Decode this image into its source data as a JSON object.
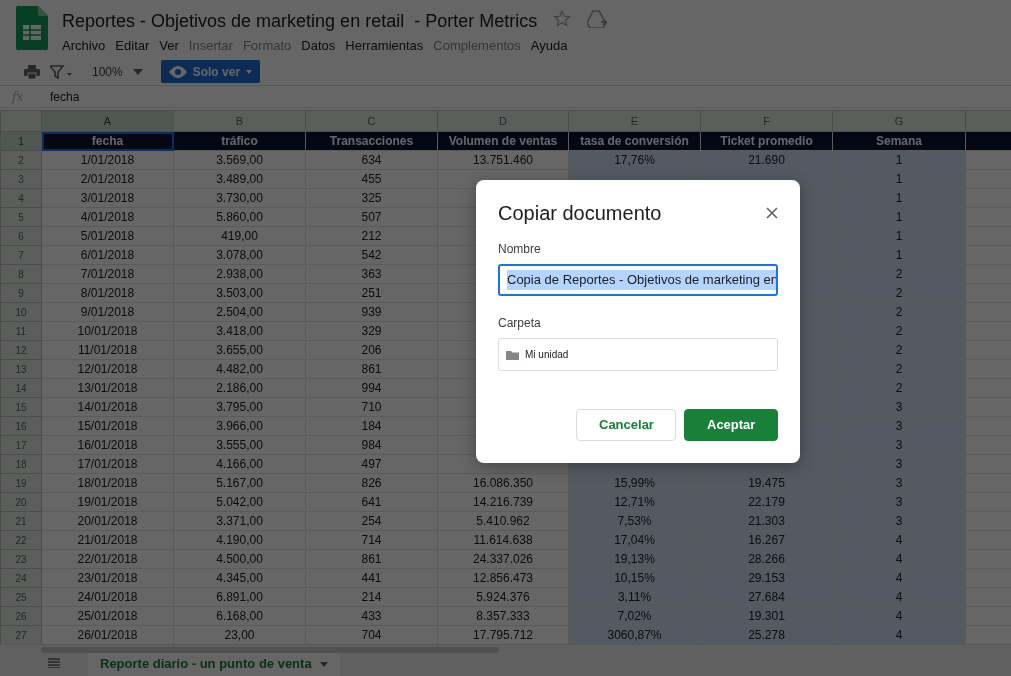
{
  "app": {
    "title": "Reportes - Objetivos de marketing en retail  - Porter Metrics",
    "starred": false,
    "menu": [
      {
        "label": "Archivo",
        "disabled": false
      },
      {
        "label": "Editar",
        "disabled": false
      },
      {
        "label": "Ver",
        "disabled": false
      },
      {
        "label": "Insertar",
        "disabled": true
      },
      {
        "label": "Formato",
        "disabled": true
      },
      {
        "label": "Datos",
        "disabled": false
      },
      {
        "label": "Herramientas",
        "disabled": false
      },
      {
        "label": "Complementos",
        "disabled": true
      },
      {
        "label": "Ayuda",
        "disabled": false
      }
    ]
  },
  "toolbar": {
    "zoom": "100%",
    "mode_button": "Solo ver"
  },
  "formula_bar": {
    "fx": "fx",
    "value": "fecha"
  },
  "sheet": {
    "columns": [
      {
        "label": "A",
        "highlighted": false,
        "selected": true
      },
      {
        "label": "B",
        "highlighted": false,
        "selected": false
      },
      {
        "label": "C",
        "highlighted": false,
        "selected": false
      },
      {
        "label": "D",
        "highlighted": false,
        "selected": false
      },
      {
        "label": "E",
        "highlighted": true,
        "selected": false
      },
      {
        "label": "F",
        "highlighted": true,
        "selected": false
      },
      {
        "label": "G",
        "highlighted": true,
        "selected": false
      }
    ],
    "rows": [
      {
        "number": "1",
        "header": true,
        "cells": [
          "fecha",
          "tráfico",
          "Transacciones",
          "Volumen de ventas",
          "tasa de conversión",
          "Ticket promedio",
          "Semana"
        ]
      },
      {
        "number": "2",
        "header": false,
        "cells": [
          "1/01/2018",
          "3.569,00",
          "634",
          "13.751.460",
          "17,76%",
          "21.690",
          "1"
        ]
      },
      {
        "number": "3",
        "header": false,
        "cells": [
          "2/01/2018",
          "3.489,00",
          "455",
          null,
          null,
          null,
          "1"
        ]
      },
      {
        "number": "4",
        "header": false,
        "cells": [
          "3/01/2018",
          "3.730,00",
          "325",
          null,
          null,
          null,
          "1"
        ]
      },
      {
        "number": "5",
        "header": false,
        "cells": [
          "4/01/2018",
          "5.860,00",
          "507",
          null,
          null,
          null,
          "1"
        ]
      },
      {
        "number": "6",
        "header": false,
        "cells": [
          "5/01/2018",
          "419,00",
          "212",
          null,
          null,
          null,
          "1"
        ]
      },
      {
        "number": "7",
        "header": false,
        "cells": [
          "6/01/2018",
          "3.078,00",
          "542",
          null,
          null,
          null,
          "1"
        ]
      },
      {
        "number": "8",
        "header": false,
        "cells": [
          "7/01/2018",
          "2.938,00",
          "363",
          null,
          null,
          null,
          "2"
        ]
      },
      {
        "number": "9",
        "header": false,
        "cells": [
          "8/01/2018",
          "3.503,00",
          "251",
          null,
          null,
          null,
          "2"
        ]
      },
      {
        "number": "10",
        "header": false,
        "cells": [
          "9/01/2018",
          "2.504,00",
          "939",
          null,
          null,
          null,
          "2"
        ]
      },
      {
        "number": "11",
        "header": false,
        "cells": [
          "10/01/2018",
          "3.418,00",
          "329",
          null,
          null,
          null,
          "2"
        ]
      },
      {
        "number": "12",
        "header": false,
        "cells": [
          "11/01/2018",
          "3.655,00",
          "206",
          null,
          null,
          null,
          "2"
        ]
      },
      {
        "number": "13",
        "header": false,
        "cells": [
          "12/01/2018",
          "4.482,00",
          "861",
          null,
          null,
          null,
          "2"
        ]
      },
      {
        "number": "14",
        "header": false,
        "cells": [
          "13/01/2018",
          "2.186,00",
          "994",
          null,
          null,
          null,
          "2"
        ]
      },
      {
        "number": "15",
        "header": false,
        "cells": [
          "14/01/2018",
          "3.795,00",
          "710",
          null,
          null,
          null,
          "3"
        ]
      },
      {
        "number": "16",
        "header": false,
        "cells": [
          "15/01/2018",
          "3.966,00",
          "184",
          null,
          null,
          null,
          "3"
        ]
      },
      {
        "number": "17",
        "header": false,
        "cells": [
          "16/01/2018",
          "3.555,00",
          "984",
          null,
          null,
          null,
          "3"
        ]
      },
      {
        "number": "18",
        "header": false,
        "cells": [
          "17/01/2018",
          "4.166,00",
          "497",
          null,
          null,
          null,
          "3"
        ]
      },
      {
        "number": "19",
        "header": false,
        "cells": [
          "18/01/2018",
          "5.167,00",
          "826",
          "16.086.350",
          "15,99%",
          "19.475",
          "3"
        ]
      },
      {
        "number": "20",
        "header": false,
        "cells": [
          "19/01/2018",
          "5.042,00",
          "641",
          "14.216.739",
          "12,71%",
          "22.179",
          "3"
        ]
      },
      {
        "number": "21",
        "header": false,
        "cells": [
          "20/01/2018",
          "3.371,00",
          "254",
          "5.410.962",
          "7,53%",
          "21.303",
          "3"
        ]
      },
      {
        "number": "22",
        "header": false,
        "cells": [
          "21/01/2018",
          "4.190,00",
          "714",
          "11.614.638",
          "17,04%",
          "16.267",
          "4"
        ]
      },
      {
        "number": "23",
        "header": false,
        "cells": [
          "22/01/2018",
          "4.500,00",
          "861",
          "24.337.026",
          "19,13%",
          "28.266",
          "4"
        ]
      },
      {
        "number": "24",
        "header": false,
        "cells": [
          "23/01/2018",
          "4.345,00",
          "441",
          "12.856.473",
          "10,15%",
          "29.153",
          "4"
        ]
      },
      {
        "number": "25",
        "header": false,
        "cells": [
          "24/01/2018",
          "6.891,00",
          "214",
          "5.924.376",
          "3,11%",
          "27.684",
          "4"
        ]
      },
      {
        "number": "26",
        "header": false,
        "cells": [
          "25/01/2018",
          "6.168,00",
          "433",
          "8.357.333",
          "7,02%",
          "19.301",
          "4"
        ]
      },
      {
        "number": "27",
        "header": false,
        "cells": [
          "26/01/2018",
          "23,00",
          "704",
          "17.795.712",
          "3060,87%",
          "25.278",
          "4"
        ]
      }
    ]
  },
  "sheet_tabs": [
    {
      "label": "Reporte diario - un punto de venta",
      "selected": true
    }
  ],
  "dialog": {
    "title": "Copiar documento",
    "fields": [
      {
        "kind": "text",
        "label": "Nombre",
        "value": "Copia de Reportes - Objetivos de marketing en",
        "focused": true,
        "text_selected": true
      },
      {
        "kind": "folder",
        "label": "Carpeta",
        "value": "Mi unidad",
        "focused": false,
        "text_selected": false
      }
    ],
    "buttons": [
      {
        "label": "Cancelar",
        "kind": "secondary"
      },
      {
        "label": "Aceptar",
        "kind": "primary"
      }
    ]
  }
}
